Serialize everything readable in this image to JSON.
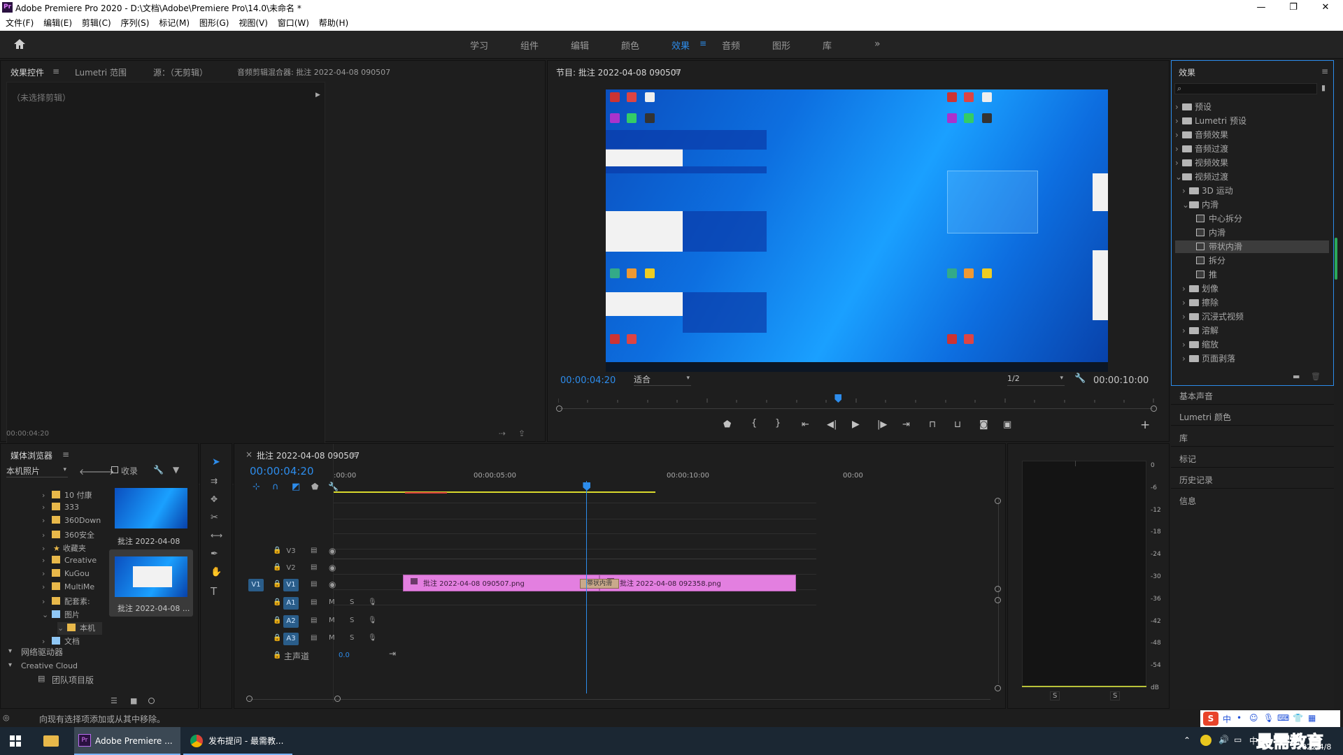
{
  "window": {
    "title": "Adobe Premiere Pro 2020 - D:\\文档\\Adobe\\Premiere Pro\\14.0\\未命名 *",
    "app_icon": "Pr",
    "min": "—",
    "max": "❐",
    "close": "✕"
  },
  "menu": [
    "文件(F)",
    "编辑(E)",
    "剪辑(C)",
    "序列(S)",
    "标记(M)",
    "图形(G)",
    "视图(V)",
    "窗口(W)",
    "帮助(H)"
  ],
  "workspaces": [
    "学习",
    "组件",
    "编辑",
    "颜色",
    "效果",
    "音频",
    "图形",
    "库"
  ],
  "active_workspace": "效果",
  "source_panel": {
    "tabs": [
      "效果控件",
      "Lumetri 范围",
      "源：（无剪辑）",
      "音频剪辑混合器: 批注 2022-04-08 090507"
    ],
    "no_clip": "（未选择剪辑）",
    "timecode": "00:00:04:20"
  },
  "program": {
    "title": "节目: 批注 2022-04-08 090507",
    "timecode": "00:00:04:20",
    "fit": "适合",
    "resolution": "1/2",
    "duration": "00:00:10:00",
    "playhead_fraction": 0.47
  },
  "effects": {
    "title": "效果",
    "search_placeholder": "",
    "tree": [
      {
        "label": "预设",
        "level": 0,
        "type": "folder",
        "open": false
      },
      {
        "label": "Lumetri 预设",
        "level": 0,
        "type": "folder",
        "open": false
      },
      {
        "label": "音频效果",
        "level": 0,
        "type": "folder",
        "open": false
      },
      {
        "label": "音频过渡",
        "level": 0,
        "type": "folder",
        "open": false
      },
      {
        "label": "视频效果",
        "level": 0,
        "type": "folder",
        "open": false
      },
      {
        "label": "视频过渡",
        "level": 0,
        "type": "folder",
        "open": true
      },
      {
        "label": "3D 运动",
        "level": 1,
        "type": "folder",
        "open": false
      },
      {
        "label": "内滑",
        "level": 1,
        "type": "folder",
        "open": true
      },
      {
        "label": "中心拆分",
        "level": 2,
        "type": "item"
      },
      {
        "label": "内滑",
        "level": 2,
        "type": "item"
      },
      {
        "label": "带状内滑",
        "level": 2,
        "type": "item",
        "selected": true
      },
      {
        "label": "拆分",
        "level": 2,
        "type": "item"
      },
      {
        "label": "推",
        "level": 2,
        "type": "item"
      },
      {
        "label": "划像",
        "level": 1,
        "type": "folder",
        "open": false
      },
      {
        "label": "擦除",
        "level": 1,
        "type": "folder",
        "open": false
      },
      {
        "label": "沉浸式视频",
        "level": 1,
        "type": "folder",
        "open": false
      },
      {
        "label": "溶解",
        "level": 1,
        "type": "folder",
        "open": false
      },
      {
        "label": "缩放",
        "level": 1,
        "type": "folder",
        "open": false
      },
      {
        "label": "页面剥落",
        "level": 1,
        "type": "folder",
        "open": false
      }
    ],
    "stacked": [
      "基本声音",
      "Lumetri 颜色",
      "库",
      "标记",
      "历史记录",
      "信息"
    ]
  },
  "media_browser": {
    "title": "媒体浏览器",
    "location": "本机照片",
    "collect": "收录",
    "tree": [
      {
        "label": "10 付康",
        "icon": "folder"
      },
      {
        "label": "333",
        "icon": "folder"
      },
      {
        "label": "360Down",
        "icon": "folder"
      },
      {
        "label": "360安全",
        "icon": "folder"
      },
      {
        "label": "收藏夹",
        "icon": "star"
      },
      {
        "label": "Creative",
        "icon": "folder"
      },
      {
        "label": "KuGou",
        "icon": "folder"
      },
      {
        "label": "MultiMe",
        "icon": "folder"
      },
      {
        "label": "配套素:",
        "icon": "folder"
      },
      {
        "label": "图片",
        "icon": "pic"
      },
      {
        "label": "本机",
        "icon": "folder"
      },
      {
        "label": "文档",
        "icon": "doc"
      }
    ],
    "network": "网络驱动器",
    "cc": "Creative Cloud",
    "team": "团队项目版",
    "thumbs": [
      "批注 2022-04-08 ...",
      "批注 2022-04-08 ..."
    ]
  },
  "timeline": {
    "tab": "批注 2022-04-08 090507",
    "timecode": "00:00:04:20",
    "ruler": [
      ":00:00",
      "00:00:05:00",
      "00:00:10:00",
      "00:00"
    ],
    "video_tracks": [
      "V3",
      "V2",
      "V1"
    ],
    "audio_tracks": [
      "A1",
      "A2",
      "A3"
    ],
    "src_patch": "V1",
    "master": "主声道",
    "master_val": "0.0",
    "clips": [
      {
        "name": "批注 2022-04-08 090507.png",
        "start": 0,
        "end": 5
      },
      {
        "name": "批注 2022-04-08 092358.png",
        "start": 5,
        "end": 10
      }
    ],
    "transition": "带状内滑",
    "playhead_seconds": 4.67,
    "view_seconds": 14.2
  },
  "meter": {
    "scale": [
      "0",
      "-6",
      "-12",
      "-18",
      "-24",
      "-30",
      "-36",
      "-42",
      "-48",
      "-54",
      "dB"
    ],
    "solo": [
      "S",
      "S"
    ]
  },
  "status": "向现有选择项添加或从其中移除。",
  "taskbar": {
    "items": [
      "Adobe Premiere ...",
      "发布提问 - 最需教..."
    ],
    "ime": "中",
    "date": "2022/4/8",
    "watermark": "最需教育"
  }
}
